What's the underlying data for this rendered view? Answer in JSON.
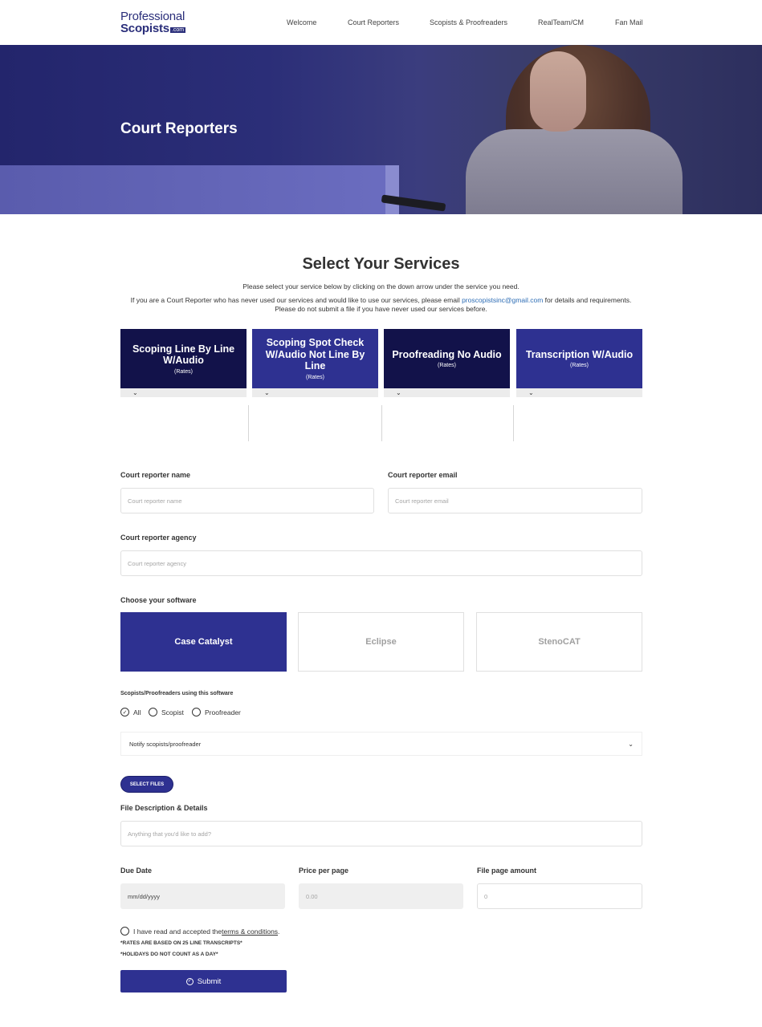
{
  "header": {
    "logo": {
      "line1": "Professional",
      "line2": "Scopists",
      "suffix": ".com"
    },
    "nav": [
      "Welcome",
      "Court Reporters",
      "Scopists & Proofreaders",
      "RealTeam/CM",
      "Fan Mail"
    ]
  },
  "hero": {
    "title": "Court Reporters"
  },
  "intro": {
    "title": "Select Your Services",
    "line1": "Please select your service below by clicking on the down arrow under the service you need.",
    "line2_pre": "If you are a Court Reporter who has never used our services and would like to use our services, please email ",
    "email": "proscopistsinc@gmail.com",
    "line2_post": " for details and requirements.",
    "line3": "Please do not submit a file if you have never used our services before."
  },
  "services": [
    {
      "name": "Scoping Line By Line W/Audio",
      "rates": "(Rates)"
    },
    {
      "name": "Scoping Spot Check W/Audio Not Line By Line",
      "rates": "(Rates)"
    },
    {
      "name": "Proofreading No Audio",
      "rates": "(Rates)"
    },
    {
      "name": "Transcription W/Audio",
      "rates": "(Rates)"
    }
  ],
  "form": {
    "name_label": "Court reporter name",
    "name_placeholder": "Court reporter name",
    "email_label": "Court reporter email",
    "email_placeholder": "Court reporter email",
    "agency_label": "Court reporter agency",
    "agency_placeholder": "Court reporter agency",
    "software_label": "Choose your software",
    "software": [
      "Case Catalyst",
      "Eclipse",
      "StenoCAT"
    ],
    "software_selected": "Case Catalyst",
    "scopists_label": "Scopists/Proofreaders using this software",
    "radios": [
      "All",
      "Scopist",
      "Proofreader"
    ],
    "radio_selected": "All",
    "notify_select": "Notify scopists/proofreader",
    "select_files": "SELECT FILES",
    "description_label": "File Description & Details",
    "description_placeholder": "Anything that you'd like to add?",
    "due_label": "Due Date",
    "due_value": "mm/dd/yyyy",
    "price_label": "Price per page",
    "price_placeholder": "0.00",
    "pages_label": "File page amount",
    "pages_placeholder": "0",
    "terms_pre": "I have read and accepted the ",
    "terms_link": "terms & conditions",
    "terms_post": ".",
    "note1": "*RATES ARE BASED ON 25 LINE TRANSCRIPTS*",
    "note2": "*HOLIDAYS DO NOT COUNT AS A DAY*",
    "submit": "Submit"
  },
  "colors": {
    "brand": "#2e3191",
    "brand_dark": "#12124a",
    "link": "#2d6db5"
  }
}
